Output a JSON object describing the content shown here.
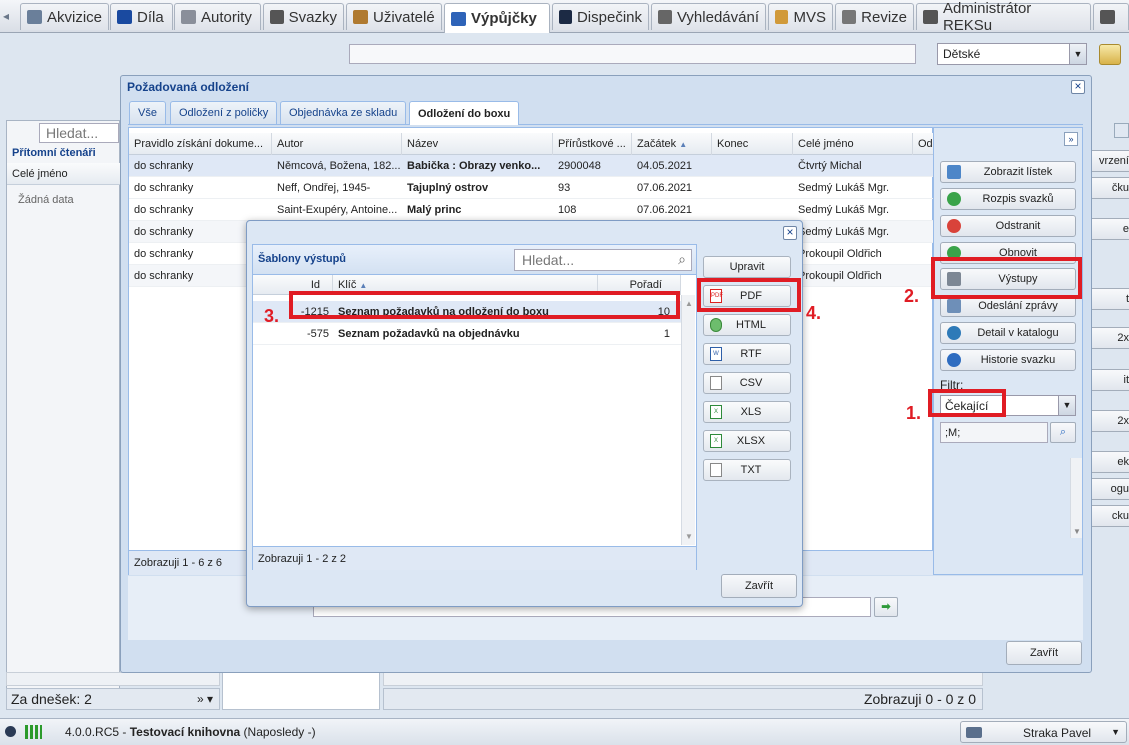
{
  "top_tabs": [
    {
      "label": "Akvizice",
      "icon": "cart-icon",
      "color": "#6a7f9a"
    },
    {
      "label": "Díla",
      "icon": "book-icon",
      "color": "#1a4aa0"
    },
    {
      "label": "Autority",
      "icon": "id-card-icon",
      "color": "#8a8f9a"
    },
    {
      "label": "Svazky",
      "icon": "pen-icon",
      "color": "#555"
    },
    {
      "label": "Uživatelé",
      "icon": "users-icon",
      "color": "#b07a30"
    },
    {
      "label": "Výpůjčky",
      "icon": "books-icon",
      "color": "#2e63b8"
    },
    {
      "label": "Dispečink",
      "icon": "monitor-icon",
      "color": "#1c2a44"
    },
    {
      "label": "Vyhledávání",
      "icon": "search-window-icon",
      "color": "#666"
    },
    {
      "label": "MVS",
      "icon": "box-icon",
      "color": "#d19a3a"
    },
    {
      "label": "Revize",
      "icon": "list-icon",
      "color": "#777"
    },
    {
      "label": "Administrátor REKSu",
      "icon": "tools-icon",
      "color": "#555"
    }
  ],
  "header": {
    "dept_select": "Dětské"
  },
  "left_panel": {
    "search_placeholder": "Hledat...",
    "section_title": "Přítomní čtenáři",
    "column": "Celé jméno",
    "empty": "Žádná data",
    "footer_today": "Za dnešek: 2"
  },
  "bottom_pager": "Zobrazuji 0 - 0 z 0",
  "status_bar": {
    "version": "4.0.0.RC5",
    "separator": "-",
    "library": "Testovací knihovna",
    "last": "(Naposledy -)",
    "user": "Straka Pavel"
  },
  "window": {
    "title": "Požadovaná odložení",
    "tabs": [
      "Vše",
      "Odložení z poličky",
      "Objednávka ze skladu",
      "Odložení do boxu"
    ],
    "active_tab": 3,
    "columns": [
      "Pravidlo získání dokume...",
      "Autor",
      "Název",
      "Přírůstkové ...",
      "Začátek",
      "Konec",
      "Celé jméno",
      "Od"
    ],
    "rows": [
      [
        "do schranky",
        "Němcová, Božena, 182...",
        "Babička : Obrazy venko...",
        "2900048",
        "04.05.2021",
        "",
        "Čtvrtý Michal"
      ],
      [
        "do schranky",
        "Neff, Ondřej, 1945-",
        "Tajuplný ostrov",
        "93",
        "07.06.2021",
        "",
        "Sedmý Lukáš Mgr."
      ],
      [
        "do schranky",
        "Saint-Exupéry, Antoine...",
        "Malý princ",
        "108",
        "07.06.2021",
        "",
        "Sedmý Lukáš Mgr."
      ],
      [
        "do schranky",
        "",
        "",
        "",
        "",
        "",
        "Sedmý Lukáš Mgr."
      ],
      [
        "do schranky",
        "",
        "",
        "",
        "",
        "",
        "Prokoupil Oldřich"
      ],
      [
        "do schranky",
        "",
        "",
        "",
        "",
        "",
        "Prokoupil Oldřich"
      ]
    ],
    "pager": "Zobrazuji 1 - 6 z 6",
    "close_button": "Zavřít"
  },
  "side_buttons": [
    {
      "label": "Zobrazit lístek",
      "icon": "ticket-icon",
      "color": "#4d86c8"
    },
    {
      "label": "Rozpis svazků",
      "icon": "check-icon",
      "color": "#3aa34a"
    },
    {
      "label": "Odstranit",
      "icon": "delete-icon",
      "color": "#d9433a"
    },
    {
      "label": "Obnovit",
      "icon": "refresh-icon",
      "color": "#3aa34a"
    },
    {
      "label": "Výstupy",
      "icon": "printer-icon",
      "color": "#7d8794"
    },
    {
      "label": "Odeslání zprávy",
      "icon": "envelope-icon",
      "color": "#6e8fb8"
    },
    {
      "label": "Detail v katalogu",
      "icon": "globe-icon",
      "color": "#2e7ab8"
    },
    {
      "label": "Historie svazku",
      "icon": "info-icon",
      "color": "#2e6cc0"
    }
  ],
  "filter": {
    "label": "Filtr:",
    "value": "Čekající",
    "query": ";M;"
  },
  "right_partial": [
    "vrzení",
    "čku",
    "e",
    "t",
    "2x",
    "it",
    "2x",
    "ek",
    "ogu",
    "cku"
  ],
  "dialog": {
    "title": "Šablony výstupů",
    "search_placeholder": "Hledat...",
    "columns": [
      "Id",
      "Klíč",
      "Pořadí"
    ],
    "rows": [
      {
        "id": "-1215",
        "key": "Seznam požadavků na odložení do boxu",
        "order": "10"
      },
      {
        "id": "-575",
        "key": "Seznam požadavků na objednávku",
        "order": "1"
      }
    ],
    "pager": "Zobrazuji 1 - 2 z 2",
    "edit_button": "Upravit",
    "formats": [
      {
        "label": "PDF",
        "icon": "pdf-icon",
        "color": "#d22"
      },
      {
        "label": "HTML",
        "icon": "html-icon",
        "color": "#3a8a3a"
      },
      {
        "label": "RTF",
        "icon": "rtf-icon",
        "color": "#2e5fa8"
      },
      {
        "label": "CSV",
        "icon": "csv-icon",
        "color": "#888"
      },
      {
        "label": "XLS",
        "icon": "xls-icon",
        "color": "#2e8a3a"
      },
      {
        "label": "XLSX",
        "icon": "xlsx-icon",
        "color": "#2e8a3a"
      },
      {
        "label": "TXT",
        "icon": "txt-icon",
        "color": "#888"
      }
    ],
    "close_button": "Zavřít"
  },
  "annotations": [
    "1.",
    "2.",
    "3.",
    "4."
  ],
  "colors": {
    "annotation_red": "#e01c24",
    "title_blue": "#15428b"
  }
}
